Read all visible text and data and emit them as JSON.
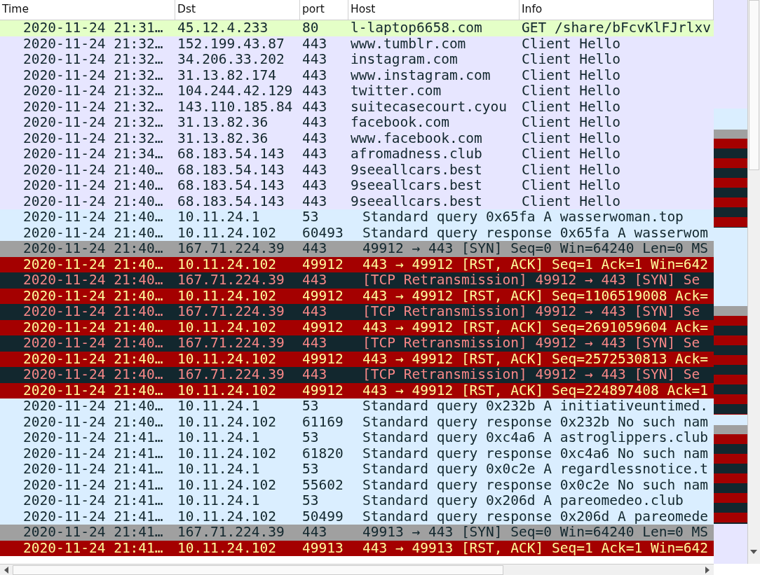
{
  "columns": [
    "Time",
    "Dst",
    "port",
    "Host",
    "Info"
  ],
  "rows": [
    {
      "kind": "http",
      "time": "2020-11-24 21:31…",
      "dst": "45.12.4.233",
      "port": "80",
      "host": "l-laptop6658.com",
      "info": "GET /share/bFcvKlFJrlxv"
    },
    {
      "kind": "tls",
      "time": "2020-11-24 21:32…",
      "dst": "152.199.43.87",
      "port": "443",
      "host": "www.tumblr.com",
      "info": "Client Hello"
    },
    {
      "kind": "tls",
      "time": "2020-11-24 21:32…",
      "dst": "34.206.33.202",
      "port": "443",
      "host": "instagram.com",
      "info": "Client Hello"
    },
    {
      "kind": "tls",
      "time": "2020-11-24 21:32…",
      "dst": "31.13.82.174",
      "port": "443",
      "host": "www.instagram.com",
      "info": "Client Hello"
    },
    {
      "kind": "tls",
      "time": "2020-11-24 21:32…",
      "dst": "104.244.42.129",
      "port": "443",
      "host": "twitter.com",
      "info": "Client Hello"
    },
    {
      "kind": "tls",
      "time": "2020-11-24 21:32…",
      "dst": "143.110.185.84",
      "port": "443",
      "host": "suitecasecourt.cyou",
      "info": "Client Hello"
    },
    {
      "kind": "tls",
      "time": "2020-11-24 21:32…",
      "dst": "31.13.82.36",
      "port": "443",
      "host": "facebook.com",
      "info": "Client Hello"
    },
    {
      "kind": "tls",
      "time": "2020-11-24 21:32…",
      "dst": "31.13.82.36",
      "port": "443",
      "host": "www.facebook.com",
      "info": "Client Hello"
    },
    {
      "kind": "tls",
      "time": "2020-11-24 21:34…",
      "dst": "68.183.54.143",
      "port": "443",
      "host": "afromadness.club",
      "info": "Client Hello"
    },
    {
      "kind": "tls",
      "time": "2020-11-24 21:40…",
      "dst": "68.183.54.143",
      "port": "443",
      "host": "9seeallcars.best",
      "info": "Client Hello"
    },
    {
      "kind": "tls",
      "time": "2020-11-24 21:40…",
      "dst": "68.183.54.143",
      "port": "443",
      "host": "9seeallcars.best",
      "info": "Client Hello"
    },
    {
      "kind": "tls",
      "time": "2020-11-24 21:40…",
      "dst": "68.183.54.143",
      "port": "443",
      "host": "9seeallcars.best",
      "info": "Client Hello"
    },
    {
      "kind": "dns",
      "time": "2020-11-24 21:40…",
      "dst": "10.11.24.1",
      "port": "53",
      "info": "Standard query 0x65fa A wasserwoman.top"
    },
    {
      "kind": "dns",
      "time": "2020-11-24 21:40…",
      "dst": "10.11.24.102",
      "port": "60493",
      "info": "Standard query response 0x65fa A wasserwom"
    },
    {
      "kind": "syn",
      "time": "2020-11-24 21:40…",
      "dst": "167.71.224.39",
      "port": "443",
      "info": "49912 → 443 [SYN] Seq=0 Win=64240 Len=0 MS"
    },
    {
      "kind": "rst",
      "time": "2020-11-24 21:40…",
      "dst": "10.11.24.102",
      "port": "49912",
      "info": "443 → 49912 [RST, ACK] Seq=1 Ack=1 Win=642"
    },
    {
      "kind": "retrans",
      "time": "2020-11-24 21:40…",
      "dst": "167.71.224.39",
      "port": "443",
      "info": "[TCP Retransmission] 49912 → 443 [SYN] Se"
    },
    {
      "kind": "rst",
      "time": "2020-11-24 21:40…",
      "dst": "10.11.24.102",
      "port": "49912",
      "info": "443 → 49912 [RST, ACK] Seq=1106519008 Ack="
    },
    {
      "kind": "retrans",
      "time": "2020-11-24 21:40…",
      "dst": "167.71.224.39",
      "port": "443",
      "info": "[TCP Retransmission] 49912 → 443 [SYN] Se"
    },
    {
      "kind": "rst",
      "time": "2020-11-24 21:40…",
      "dst": "10.11.24.102",
      "port": "49912",
      "info": "443 → 49912 [RST, ACK] Seq=2691059604 Ack="
    },
    {
      "kind": "retrans",
      "time": "2020-11-24 21:40…",
      "dst": "167.71.224.39",
      "port": "443",
      "info": "[TCP Retransmission] 49912 → 443 [SYN] Se"
    },
    {
      "kind": "rst",
      "time": "2020-11-24 21:40…",
      "dst": "10.11.24.102",
      "port": "49912",
      "info": "443 → 49912 [RST, ACK] Seq=2572530813 Ack="
    },
    {
      "kind": "retrans",
      "time": "2020-11-24 21:40…",
      "dst": "167.71.224.39",
      "port": "443",
      "info": "[TCP Retransmission] 49912 → 443 [SYN] Se"
    },
    {
      "kind": "rst",
      "time": "2020-11-24 21:40…",
      "dst": "10.11.24.102",
      "port": "49912",
      "info": "443 → 49912 [RST, ACK] Seq=224897408 Ack=1"
    },
    {
      "kind": "dns",
      "time": "2020-11-24 21:40…",
      "dst": "10.11.24.1",
      "port": "53",
      "info": "Standard query 0x232b A initiativeuntimed."
    },
    {
      "kind": "dns",
      "time": "2020-11-24 21:40…",
      "dst": "10.11.24.102",
      "port": "61169",
      "info": "Standard query response 0x232b No such nam"
    },
    {
      "kind": "dns",
      "time": "2020-11-24 21:41…",
      "dst": "10.11.24.1",
      "port": "53",
      "info": "Standard query 0xc4a6 A astroglippers.club"
    },
    {
      "kind": "dns",
      "time": "2020-11-24 21:41…",
      "dst": "10.11.24.102",
      "port": "61820",
      "info": "Standard query response 0xc4a6 No such nam"
    },
    {
      "kind": "dns",
      "time": "2020-11-24 21:41…",
      "dst": "10.11.24.1",
      "port": "53",
      "info": "Standard query 0x0c2e A regardlessnotice.t"
    },
    {
      "kind": "dns",
      "time": "2020-11-24 21:41…",
      "dst": "10.11.24.102",
      "port": "55602",
      "info": "Standard query response 0x0c2e No such nam"
    },
    {
      "kind": "dns",
      "time": "2020-11-24 21:41…",
      "dst": "10.11.24.1",
      "port": "53",
      "info": "Standard query 0x206d A pareomedeo.club"
    },
    {
      "kind": "dns",
      "time": "2020-11-24 21:41…",
      "dst": "10.11.24.102",
      "port": "50499",
      "info": "Standard query response 0x206d A pareomede"
    },
    {
      "kind": "syn",
      "time": "2020-11-24 21:41…",
      "dst": "167.71.224.39",
      "port": "443",
      "info": "49913 → 443 [SYN] Seq=0 Win=64240 Len=0 MS"
    },
    {
      "kind": "rst",
      "time": "2020-11-24 21:41…",
      "dst": "10.11.24.102",
      "port": "49913",
      "info": "443 → 49913 [RST, ACK] Seq=1 Ack=1 Win=642"
    }
  ]
}
